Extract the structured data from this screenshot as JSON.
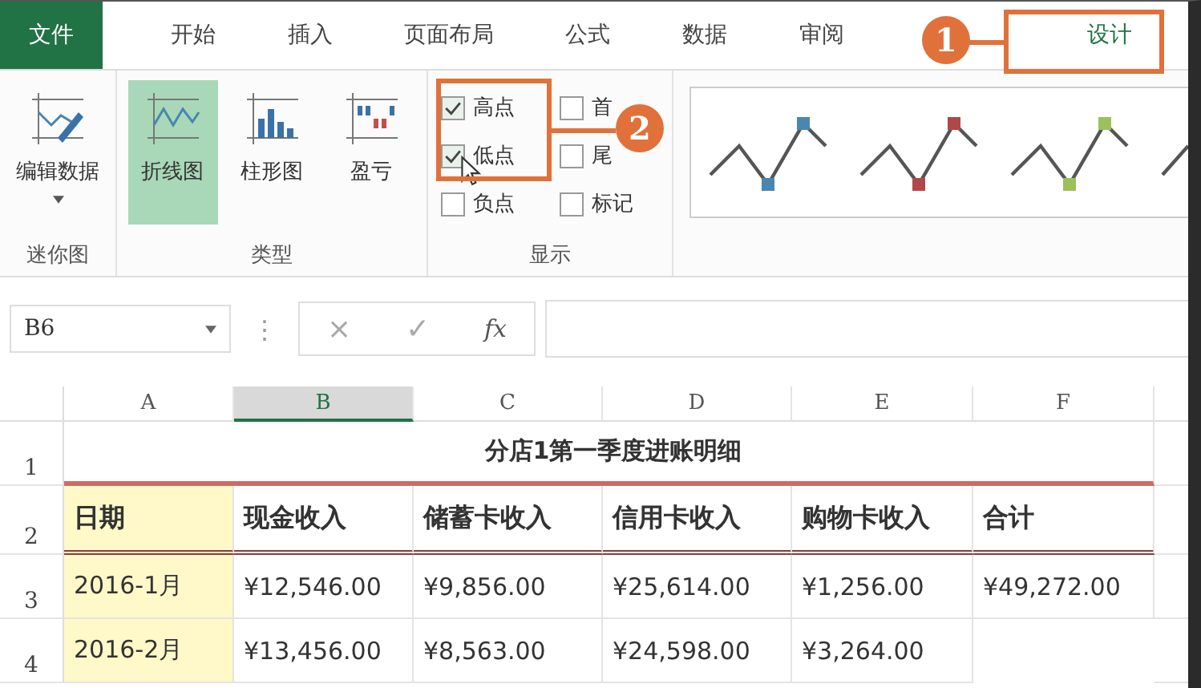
{
  "tabs": [
    {
      "label": "文件",
      "kind": "file",
      "selected": false
    },
    {
      "label": "开始",
      "kind": "tab",
      "selected": false
    },
    {
      "label": "插入",
      "kind": "tab",
      "selected": false
    },
    {
      "label": "页面布局",
      "kind": "tab",
      "selected": false
    },
    {
      "label": "公式",
      "kind": "tab",
      "selected": false
    },
    {
      "label": "数据",
      "kind": "tab",
      "selected": false
    },
    {
      "label": "审阅",
      "kind": "tab",
      "selected": false
    },
    {
      "label": "设计",
      "kind": "tab",
      "selected": true
    }
  ],
  "ribbon": {
    "groups": [
      {
        "label": "迷你图",
        "kind": "tools",
        "buttons": [
          {
            "label": "编辑数据",
            "selected": false
          }
        ]
      },
      {
        "label": "类型",
        "kind": "tools",
        "buttons": [
          {
            "label": "折线图",
            "selected": true
          },
          {
            "label": "柱形图",
            "selected": false
          },
          {
            "label": "盈亏",
            "selected": false
          }
        ]
      },
      {
        "label": "显示",
        "kind": "checks",
        "checks": [
          {
            "label": "高点",
            "checked": true
          },
          {
            "label": "首",
            "checked": false
          },
          {
            "label": "低点",
            "checked": true
          },
          {
            "label": "尾",
            "checked": false
          },
          {
            "label": "负点",
            "checked": false
          },
          {
            "label": "标记",
            "checked": false
          }
        ]
      }
    ],
    "styles": [
      {
        "color": "#4a86b0"
      },
      {
        "color": "#b04848"
      },
      {
        "color": "#9cc05a"
      }
    ]
  },
  "callouts": [
    {
      "label": "1"
    },
    {
      "label": "2"
    }
  ],
  "formula_bar": {
    "name_box": "B6",
    "handle": "⋮",
    "cancel": "×",
    "enter": "✓",
    "function": "fx"
  },
  "sheet": {
    "columns": [
      {
        "label": "A",
        "selected": false
      },
      {
        "label": "B",
        "selected": true
      },
      {
        "label": "C",
        "selected": false
      },
      {
        "label": "D",
        "selected": false
      },
      {
        "label": "E",
        "selected": false
      },
      {
        "label": "F",
        "selected": false
      }
    ],
    "rows": [
      {
        "number": "1",
        "kind": "title",
        "cells": [
          "",
          "",
          "",
          "分店1第一季度进账明细",
          "",
          ""
        ]
      },
      {
        "number": "2",
        "kind": "header",
        "cells": [
          "日期",
          "现金收入",
          "储蓄卡收入",
          "信用卡收入",
          "购物卡收入",
          "合计"
        ]
      },
      {
        "number": "3",
        "kind": "data",
        "cells": [
          "2016-1月",
          "¥12,546.00",
          "¥9,856.00",
          "¥25,614.00",
          "¥1,256.00",
          "¥49,272.00"
        ]
      },
      {
        "number": "4",
        "kind": "data",
        "cells": [
          "2016-2月",
          "¥13,456.00",
          "¥8,563.00",
          "¥24,598.00",
          "¥3,264.00"
        ]
      }
    ]
  }
}
